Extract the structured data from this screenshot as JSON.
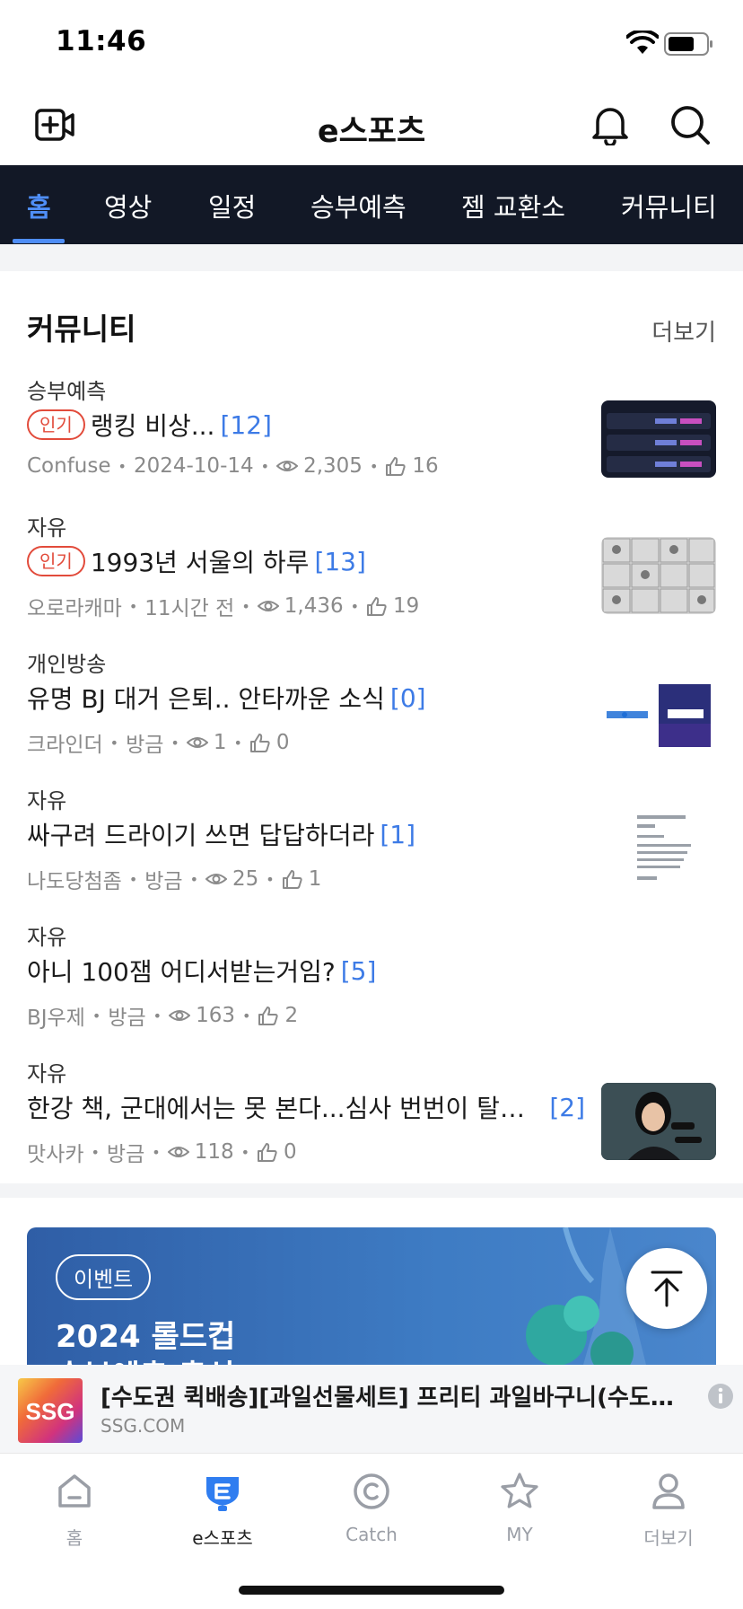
{
  "status_bar": {
    "time": "11:46"
  },
  "header": {
    "title": "e스포츠"
  },
  "tabs": [
    {
      "label": "홈",
      "active": true
    },
    {
      "label": "영상",
      "active": false
    },
    {
      "label": "일정",
      "active": false
    },
    {
      "label": "승부예측",
      "active": false
    },
    {
      "label": "젬 교환소",
      "active": false
    },
    {
      "label": "커뮤니티",
      "active": false
    }
  ],
  "community": {
    "title": "커뮤니티",
    "more_label": "더보기",
    "hot_label": "인기",
    "posts": [
      {
        "category": "승부예측",
        "hot": true,
        "title": "랭킹 비상...",
        "comments": "[12]",
        "author": "Confuse",
        "time": "2024-10-14",
        "views": "2,305",
        "likes": "16",
        "thumbnail": "dashboard-screenshot"
      },
      {
        "category": "자유",
        "hot": true,
        "title": "1993년 서울의 하루",
        "comments": "[13]",
        "author": "오로라캐마",
        "time": "11시간 전",
        "views": "1,436",
        "likes": "19",
        "thumbnail": "illustration-grid"
      },
      {
        "category": "개인방송",
        "hot": false,
        "title": "유명 BJ 대거 은퇴.. 안타까운 소식",
        "comments": "[0]",
        "author": "크라인더",
        "time": "방금",
        "views": "1",
        "likes": "0",
        "thumbnail": "afreecatv-soop-logo"
      },
      {
        "category": "자유",
        "hot": false,
        "title": "싸구려 드라이기 쓰면 답답하더라",
        "comments": "[1]",
        "author": "나도당첨좀",
        "time": "방금",
        "views": "25",
        "likes": "1",
        "thumbnail": "text-screenshot"
      },
      {
        "category": "자유",
        "hot": false,
        "title": "아니 100잼 어디서받는거임?",
        "comments": "[5]",
        "author": "BJ우제",
        "time": "방금",
        "views": "163",
        "likes": "2",
        "thumbnail": ""
      },
      {
        "category": "자유",
        "hot": false,
        "title": "한강 책, 군대에서는 못 본다...심사 번번이 탈락하...",
        "comments": "[2]",
        "author": "맛사카",
        "time": "방금",
        "views": "118",
        "likes": "0",
        "thumbnail": "woman-photo"
      }
    ]
  },
  "event_banner": {
    "tag": "이벤트",
    "title_line1": "2024 롤드컵",
    "title_line2": "승부예측 출석"
  },
  "ad": {
    "logo_text": "SSG",
    "title": "[수도권 퀵배송][과일선물세트] 프리티 과일바구니(수도권 퀵배송)",
    "source": "SSG.COM"
  },
  "bottom_nav": [
    {
      "label": "홈",
      "icon": "home-icon",
      "active": false
    },
    {
      "label": "e스포츠",
      "icon": "esports-icon",
      "active": true
    },
    {
      "label": "Catch",
      "icon": "catch-icon",
      "active": false
    },
    {
      "label": "MY",
      "icon": "star-icon",
      "active": false
    },
    {
      "label": "더보기",
      "icon": "person-icon",
      "active": false
    }
  ],
  "colors": {
    "accent": "#4f8ef7",
    "tab_bg": "#121826",
    "hot": "#e24b3b",
    "comment_count": "#3d7be6"
  }
}
